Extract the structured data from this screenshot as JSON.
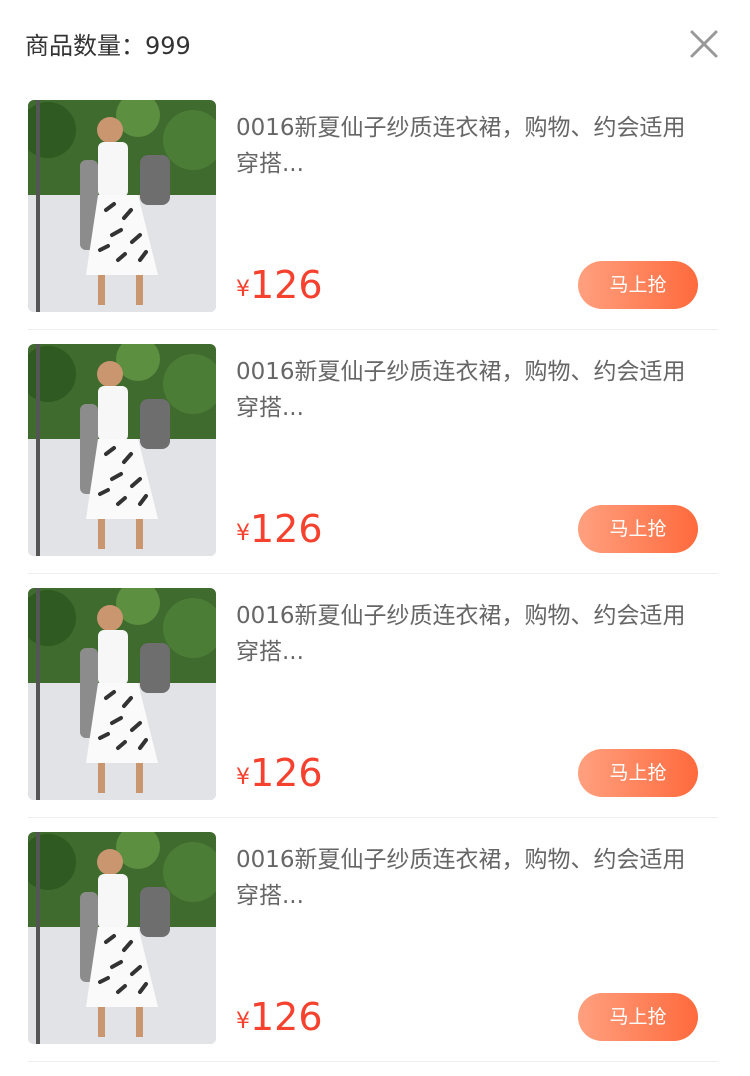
{
  "header": {
    "count_label": "商品数量：",
    "count_value": "999",
    "close_icon": "close-icon"
  },
  "products": [
    {
      "title": "0016新夏仙子纱质连衣裙，购物、约会适用穿搭...",
      "currency": "¥",
      "price": "126",
      "buy_label": "马上抢"
    },
    {
      "title": "0016新夏仙子纱质连衣裙，购物、约会适用穿搭...",
      "currency": "¥",
      "price": "126",
      "buy_label": "马上抢"
    },
    {
      "title": "0016新夏仙子纱质连衣裙，购物、约会适用穿搭...",
      "currency": "¥",
      "price": "126",
      "buy_label": "马上抢"
    },
    {
      "title": "0016新夏仙子纱质连衣裙，购物、约会适用穿搭...",
      "currency": "¥",
      "price": "126",
      "buy_label": "马上抢"
    }
  ],
  "colors": {
    "price": "#f5412e",
    "button_start": "#ffa07f",
    "button_end": "#ff6a3d",
    "divider": "#eeeeee"
  }
}
